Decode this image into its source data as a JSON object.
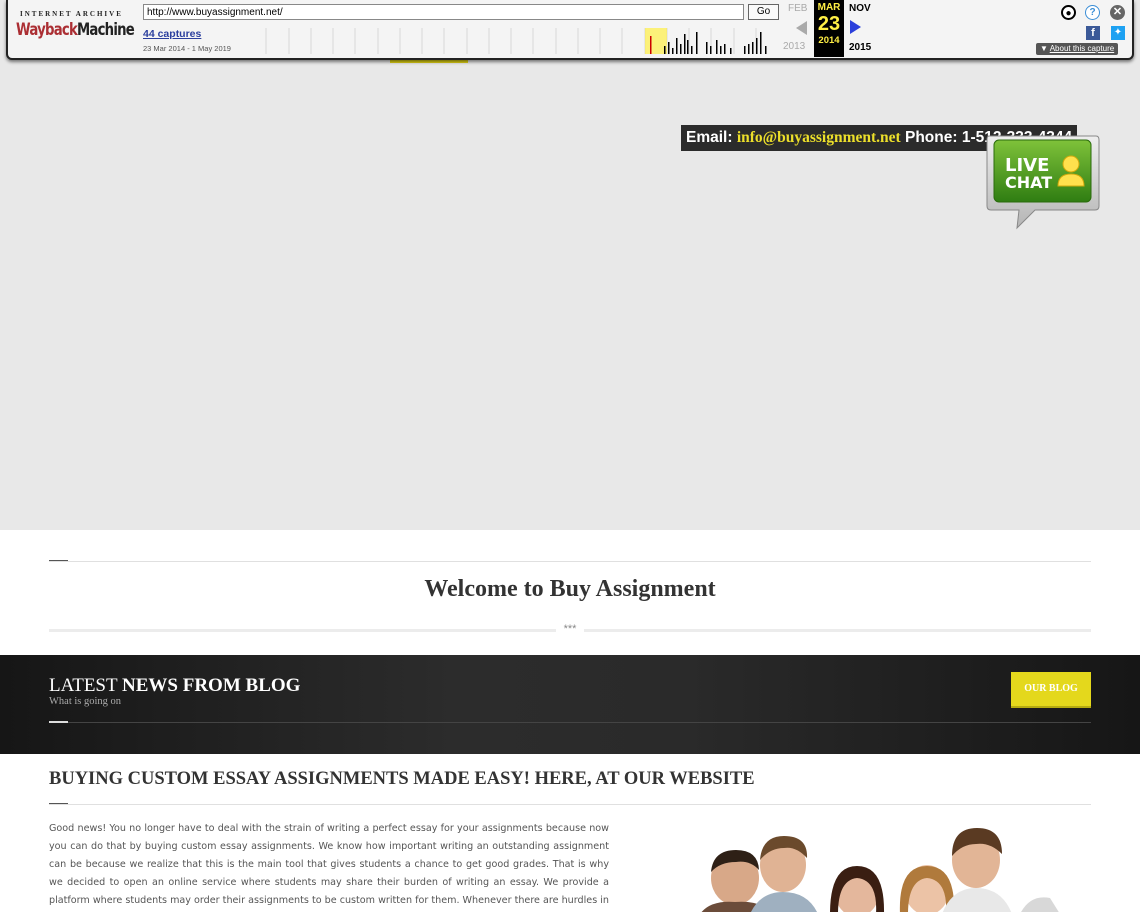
{
  "wayback": {
    "logo_top": "INTERNET ARCHIVE",
    "logo_main_a": "Wayback",
    "logo_main_b": "Machine",
    "url": "http://www.buyassignment.net/",
    "go_label": "Go",
    "captures": "44 captures",
    "range": "23 Mar 2014 - 1 May 2019",
    "prev_month": "FEB",
    "cur_month": "MAR",
    "cur_day": "23",
    "cur_year": "2014",
    "next_month": "NOV",
    "prev_year": "2013",
    "next_year": "2015",
    "about": "About this capture",
    "about_icon": "triangle-down-icon",
    "accent": "#ffef45"
  },
  "contact": {
    "email_label": "Email: ",
    "email": "info@buyassignment.net",
    "phone_label": " Phone: ",
    "phone": "1-512-333-4344",
    "accent": "#ecdf2a"
  },
  "live_chat": {
    "line1": "LIVE",
    "line2": "CHAT"
  },
  "welcome": {
    "title": "Welcome to Buy Assignment",
    "ornament": "***"
  },
  "blog": {
    "heading_light": "LATEST ",
    "heading_bold": "NEWS FROM BLOG",
    "subtitle": "What is going on",
    "button": "OUR BLOG",
    "button_color": "#e4d81c"
  },
  "essay": {
    "heading_light": "BUYING ",
    "heading_bold": "CUSTOM ESSAY ASSIGNMENTS MADE EASY! HERE, AT OUR WEBSITE",
    "body": "Good news! You no longer have to deal with the strain of writing a perfect essay for your assignments because now you can do that by buying custom essay assignments. We know how important writing an outstanding assignment can be because we realize that this is the main tool that gives students a chance to get good grades. That is why we decided to open an online service where students may share their burden of writing an essay. We provide a platform where students may order their assignments to be custom written for them. Whenever there are hurdles in writing"
  }
}
